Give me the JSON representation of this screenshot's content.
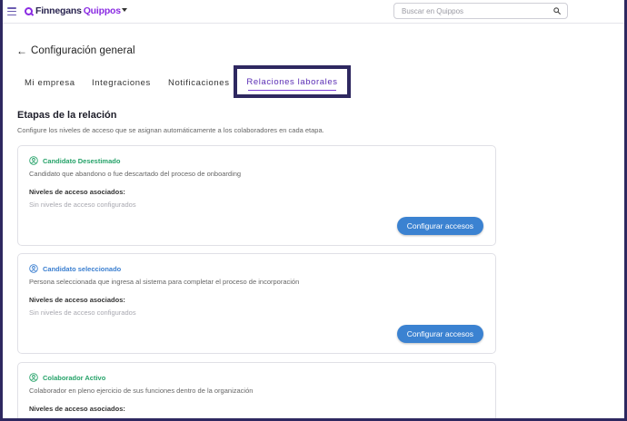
{
  "topbar": {
    "logo_part1": "Finnegans",
    "logo_part2": "Quippos",
    "search_placeholder": "Buscar en Quippos"
  },
  "header": {
    "back_arrow": "←",
    "title": "Configuración general"
  },
  "tabs": [
    {
      "label": "Mi empresa",
      "active": false
    },
    {
      "label": "Integraciones",
      "active": false
    },
    {
      "label": "Notificaciones",
      "active": false
    },
    {
      "label": "Relaciones laborales",
      "active": true
    }
  ],
  "section": {
    "title": "Etapas de la relación",
    "description": "Configure los niveles de acceso que se asignan automáticamente a los colaboradores en cada etapa."
  },
  "cards": [
    {
      "title": "Candidato Desestimado",
      "description": "Candidato que abandono o fue descartado del proceso de onboarding",
      "access_label": "Niveles de acceso asociados:",
      "empty_text": "Sin niveles de acceso configurados",
      "button": "Configurar accesos",
      "color": "#27a36a"
    },
    {
      "title": "Candidato seleccionado",
      "description": "Persona seleccionada que ingresa al sistema para completar el proceso de incorporación",
      "access_label": "Niveles de acceso asociados:",
      "empty_text": "Sin niveles de acceso configurados",
      "button": "Configurar accesos",
      "color": "#3b7fd0"
    },
    {
      "title": "Colaborador Activo",
      "description": "Colaborador en pleno ejercicio de sus funciones dentro de la organización",
      "access_label": "Niveles de acceso asociados:",
      "color": "#27a36a"
    }
  ],
  "colors": {
    "accent": "#5a2db5",
    "button": "#3b82d1",
    "frame": "#2e2860"
  }
}
